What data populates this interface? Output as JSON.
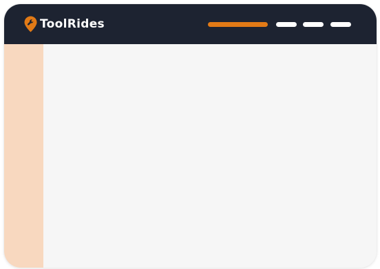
{
  "brand": {
    "name": "ToolRides",
    "logo_icon": "map-pin-wrench-icon"
  },
  "colors": {
    "header_bg": "#1d2331",
    "accent": "#e27a16",
    "nav_item": "#ffffff",
    "sidebar_bg": "#f8d8bf",
    "content_bg": "#f6f6f6"
  },
  "nav": {
    "items": [
      {
        "state": "active"
      },
      {
        "state": "inactive"
      },
      {
        "state": "inactive"
      },
      {
        "state": "inactive"
      }
    ]
  }
}
